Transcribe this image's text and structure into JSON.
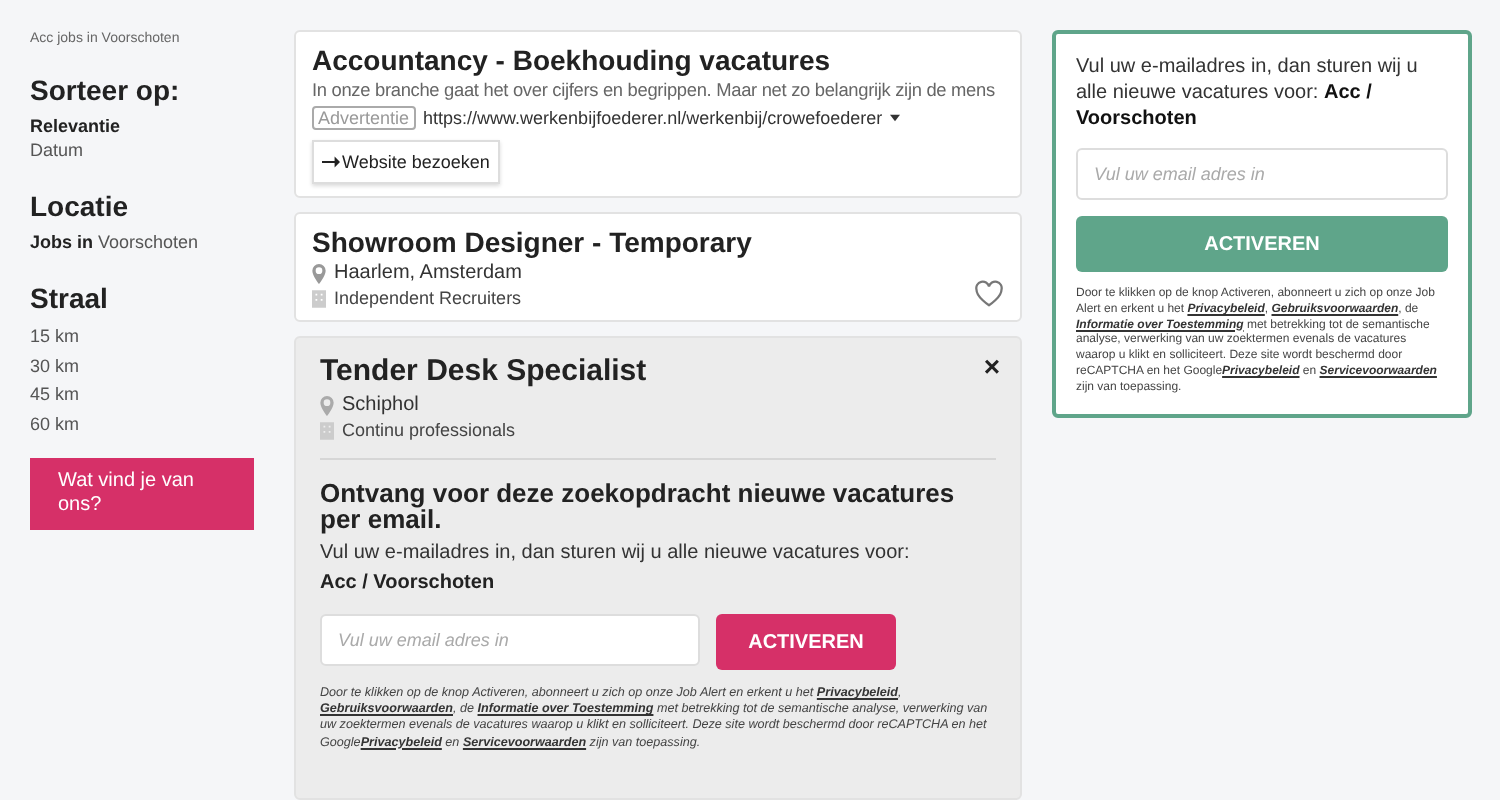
{
  "breadcrumb": "Acc jobs in Voorschoten",
  "sort": {
    "title": "Sorteer op:",
    "options": [
      {
        "label": "Relevantie",
        "selected": true
      },
      {
        "label": "Datum",
        "selected": false
      }
    ]
  },
  "location": {
    "title": "Locatie",
    "text": "**Jobs in** Voorschoten"
  },
  "radius": {
    "title": "Straal",
    "options": [
      "15 km",
      "30 km",
      "45 km",
      "60 km"
    ]
  },
  "feedback_button": "Wat vind je van ons?",
  "ad": {
    "title": "Accountancy - Boekhouding vacatures",
    "description": "In onze branche gaat het over cijfers en begrippen. Maar net zo belangrijk zijn de mens",
    "badge": "Advertentie",
    "url": "https://www.werkenbijfoederer.nl/werkenbij/crowefoederer",
    "button": "Website bezoeken"
  },
  "jobs": [
    {
      "title": "Showroom Designer - Temporary",
      "location": "Haarlem, Amsterdam",
      "company": "Independent Recruiters"
    }
  ],
  "expanded_job": {
    "title": "Tender Desk Specialist",
    "location": "Schiphol",
    "company": "Continu professionals",
    "close": "×",
    "alert": {
      "heading": "Ontvang voor deze zoekopdracht nieuwe vacatures per email.",
      "text": "Vul uw e-mailadres in, dan sturen wij u alle nieuwe vacatures voor:",
      "target": "Acc / Voorschoten",
      "placeholder": "Vul uw email adres in",
      "button": "ACTIVEREN",
      "legal": [
        {
          "kind": "text",
          "text": "Door te klikken op de knop Activeren, abonneert u zich op onze Job Alert en erkent u het "
        },
        {
          "kind": "link",
          "text": "Privacybeleid"
        },
        {
          "kind": "text",
          "text": ", "
        },
        {
          "kind": "link",
          "text": "Gebruiksvoorwaarden"
        },
        {
          "kind": "text",
          "text": ", de "
        },
        {
          "kind": "link",
          "text": "Informatie over Toestemming"
        },
        {
          "kind": "text",
          "text": " met betrekking tot de semantische analyse, verwerking van uw zoektermen evenals de vacatures waarop u klikt en solliciteert. Deze site wordt beschermd door reCAPTCHA en het Google"
        },
        {
          "kind": "link",
          "text": "Privacybeleid"
        },
        {
          "kind": "text",
          "text": " en "
        },
        {
          "kind": "link",
          "text": "Servicevoorwaarden"
        },
        {
          "kind": "text",
          "text": " zijn van toepassing."
        }
      ]
    }
  },
  "side_alert": {
    "text": "Vul uw e-mailadres in, dan sturen wij u alle nieuwe vacatures voor: **Acc / Voorschoten**",
    "placeholder": "Vul uw email adres in",
    "button": "ACTIVEREN",
    "legal": [
      {
        "kind": "text",
        "text": "Door te klikken op de knop Activeren, abonneert u zich op onze Job Alert en erkent u het "
      },
      {
        "kind": "link",
        "text": "Privacybeleid"
      },
      {
        "kind": "text",
        "text": ", "
      },
      {
        "kind": "link",
        "text": "Gebruiksvoorwaarden"
      },
      {
        "kind": "text",
        "text": ", de "
      },
      {
        "kind": "link",
        "text": "Informatie over Toestemming"
      },
      {
        "kind": "text",
        "text": " met betrekking tot de semantische analyse, verwerking van uw zoektermen evenals de vacatures waarop u klikt en solliciteert. Deze site wordt beschermd door reCAPTCHA en het Google"
      },
      {
        "kind": "link",
        "text": "Privacybeleid"
      },
      {
        "kind": "text",
        "text": " en "
      },
      {
        "kind": "link",
        "text": "Servicevoorwaarden"
      },
      {
        "kind": "text",
        "text": " zijn van toepassing."
      }
    ]
  }
}
